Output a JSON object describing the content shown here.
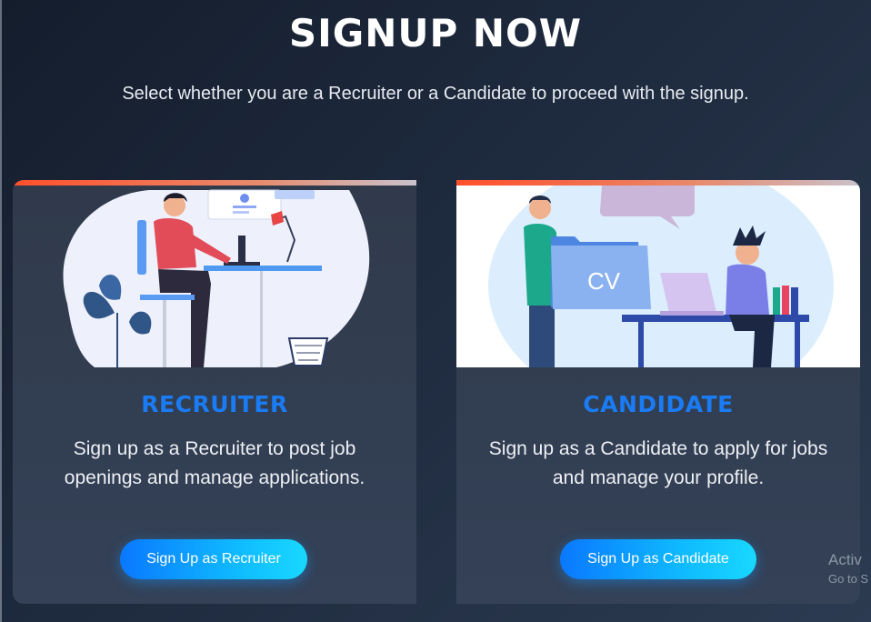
{
  "header": {
    "title": "SIGNUP NOW",
    "subtitle": "Select whether you are a Recruiter or a Candidate to proceed with the signup."
  },
  "cards": [
    {
      "title": "RECRUITER",
      "description": "Sign up as a Recruiter to post job openings and manage applications.",
      "button_label": "Sign Up as Recruiter",
      "illustration": "person-working-at-desk-illustration"
    },
    {
      "title": "CANDIDATE",
      "description": "Sign up as a Candidate to apply for jobs and manage your profile.",
      "button_label": "Sign Up as Candidate",
      "illustration": "cv-folder-and-candidate-illustration",
      "cv_text": "CV"
    }
  ],
  "watermark": {
    "line1": "Activ",
    "line2": "Go to S"
  },
  "colors": {
    "accent_title": "#1a7cf5",
    "button_gradient_start": "#0a78ff",
    "button_gradient_end": "#18d8ff",
    "card_top_bar": "#ff4f2b"
  }
}
